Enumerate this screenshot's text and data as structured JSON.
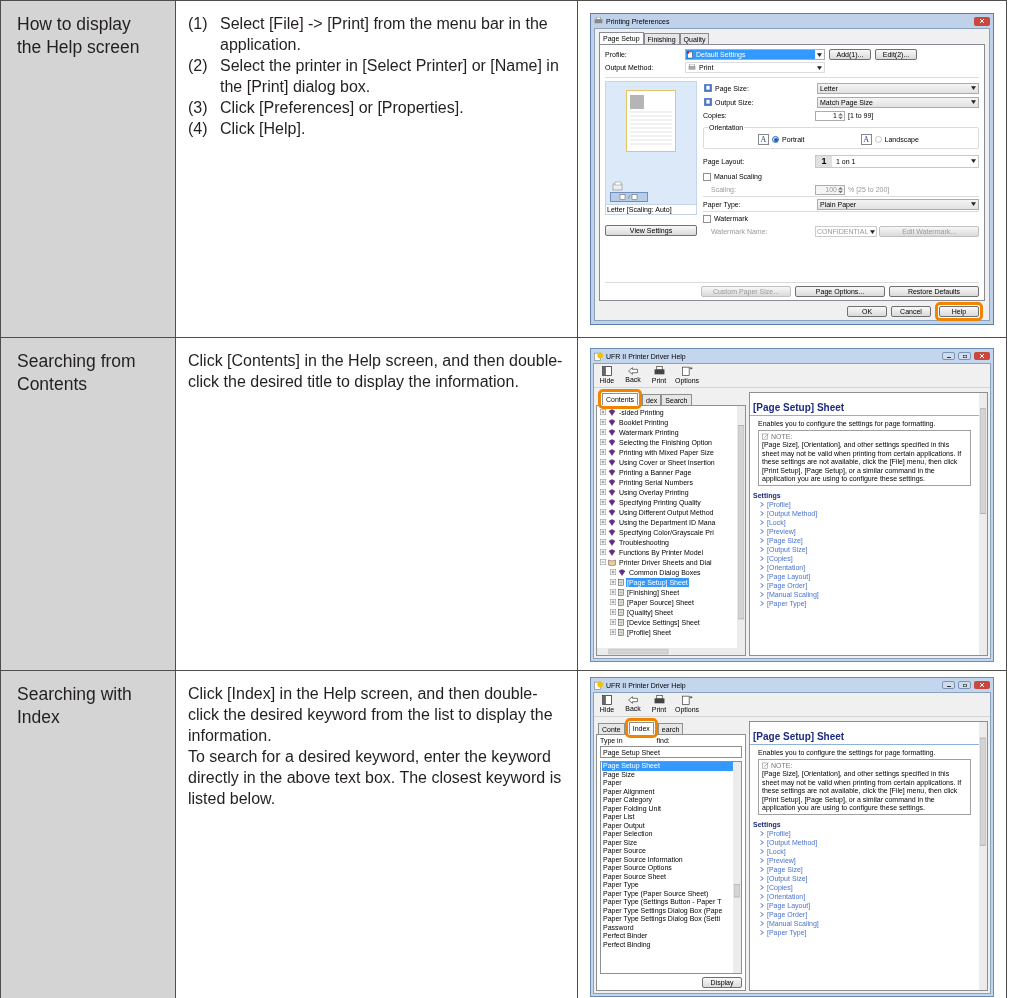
{
  "rows": [
    {
      "heading": "How to display the Help screen",
      "steps": [
        {
          "number": "(1)",
          "text": "Select [File] -> [Print] from the menu bar in the application."
        },
        {
          "number": "(2)",
          "text": "Select the printer in [Select Printer] or [Name] in the [Print] dialog box."
        },
        {
          "number": "(3)",
          "text": "Click [Preferences] or [Properties]."
        },
        {
          "number": "(4)",
          "text": "Click [Help]."
        }
      ],
      "screen": {
        "kind": "printing_preferences",
        "title": "Printing Preferences",
        "tabs": [
          {
            "label": "Page Setup",
            "selected": true
          },
          {
            "label": "Finishing",
            "selected": false
          },
          {
            "label": "Quality",
            "selected": false
          }
        ],
        "profile": {
          "label": "Profile:",
          "value": "Default Settings",
          "buttons": [
            "Add(1)...",
            "Edit(2)..."
          ]
        },
        "output_method": {
          "label": "Output Method:",
          "value": "Print"
        },
        "preview": {
          "caption": "Letter [Scaling: Auto]",
          "button": "View Settings"
        },
        "settings": [
          {
            "kind": "icon_select",
            "label": "Page Size:",
            "value": "Letter"
          },
          {
            "kind": "icon_select",
            "label": "Output Size:",
            "value": "Match Page Size"
          },
          {
            "kind": "spinner",
            "label": "Copies:",
            "value": "1",
            "range": "[1 to 99]",
            "disabled": false
          },
          {
            "kind": "orientation",
            "label": "Orientation",
            "options": [
              {
                "glyph": "A",
                "label": "Portrait",
                "selected": true
              },
              {
                "glyph": "A",
                "label": "Landscape",
                "selected": false
              }
            ]
          },
          {
            "kind": "layout_select",
            "label": "Page Layout:",
            "badge": "1",
            "value": "1 on 1"
          },
          {
            "kind": "checkbox",
            "label": "Manual Scaling",
            "checked": false
          },
          {
            "kind": "spinner",
            "label": "Scaling:",
            "value": "100",
            "range": "% [25 to 200]",
            "disabled": true
          },
          {
            "kind": "select",
            "label": "Paper Type:",
            "value": "Plain Paper"
          },
          {
            "kind": "checkbox",
            "label": "Watermark",
            "checked": false
          },
          {
            "kind": "watermark",
            "label": "Watermark Name:",
            "value": "CONFIDENTIAL",
            "button": "Edit Watermark...",
            "disabled": true
          }
        ],
        "bottom_buttons": [
          {
            "label": "Custom Paper Size...",
            "disabled": true
          },
          {
            "label": "Page Options...",
            "disabled": false
          },
          {
            "label": "Restore Defaults",
            "disabled": false
          }
        ],
        "dialog_buttons": [
          {
            "label": "OK",
            "highlighted": false
          },
          {
            "label": "Cancel",
            "highlighted": false
          },
          {
            "label": "Help",
            "highlighted": true
          }
        ]
      }
    },
    {
      "heading": "Searching from Contents",
      "paragraphs": [
        "Click [Contents] in the Help screen, and then double-click the desired title to display the information."
      ],
      "screen": {
        "kind": "help",
        "title": "UFR II Printer Driver Help",
        "toolbar": [
          "Hide",
          "Back",
          "Print",
          "Options"
        ],
        "tabs": [
          {
            "label": "Contents",
            "selected": true,
            "highlighted": true
          },
          {
            "label": "dex",
            "selected": false,
            "highlighted": false
          },
          {
            "label": "Search",
            "selected": false,
            "highlighted": false
          }
        ],
        "left_pane": {
          "kind": "contents",
          "tree": [
            {
              "label": "-sided Printing",
              "kind": "book",
              "expanded": false,
              "selected": false
            },
            {
              "label": "Booklet Printing",
              "kind": "book",
              "expanded": false,
              "selected": false
            },
            {
              "label": "Watermark Printing",
              "kind": "book",
              "expanded": false,
              "selected": false
            },
            {
              "label": "Selecting the Finishing Option",
              "kind": "book",
              "expanded": false,
              "selected": false
            },
            {
              "label": "Printing with Mixed Paper Size",
              "kind": "book",
              "expanded": false,
              "selected": false
            },
            {
              "label": "Using Cover or Sheet Insertion",
              "kind": "book",
              "expanded": false,
              "selected": false
            },
            {
              "label": "Printing a Banner Page",
              "kind": "book",
              "expanded": false,
              "selected": false
            },
            {
              "label": "Printing Serial Numbers",
              "kind": "book",
              "expanded": false,
              "selected": false
            },
            {
              "label": "Using Overlay Printing",
              "kind": "book",
              "expanded": false,
              "selected": false
            },
            {
              "label": "Specifying Printing Quality",
              "kind": "book",
              "expanded": false,
              "selected": false
            },
            {
              "label": "Using Different Output Method",
              "kind": "book",
              "expanded": false,
              "selected": false
            },
            {
              "label": "Using the Department ID Mana",
              "kind": "book",
              "expanded": false,
              "selected": false
            },
            {
              "label": "Specifying Color/Grayscale Pri",
              "kind": "book",
              "expanded": false,
              "selected": false
            },
            {
              "label": "Troubleshooting",
              "kind": "book",
              "expanded": false,
              "selected": false
            },
            {
              "label": "Functions By Printer Model",
              "kind": "book",
              "expanded": false,
              "selected": false
            },
            {
              "label": "Printer Driver Sheets and Dial",
              "kind": "book",
              "expanded": true,
              "selected": false,
              "children": [
                {
                  "label": "Common Dialog Boxes",
                  "kind": "book",
                  "expanded": false,
                  "selected": false
                },
                {
                  "label": "[Page Setup] Sheet",
                  "kind": "page",
                  "expanded": false,
                  "selected": true
                },
                {
                  "label": "[Finishing] Sheet",
                  "kind": "page",
                  "expanded": false,
                  "selected": false
                },
                {
                  "label": "[Paper Source] Sheet",
                  "kind": "page",
                  "expanded": false,
                  "selected": false
                },
                {
                  "label": "[Quality] Sheet",
                  "kind": "page",
                  "expanded": false,
                  "selected": false
                },
                {
                  "label": "[Device Settings] Sheet",
                  "kind": "page",
                  "expanded": false,
                  "selected": false
                },
                {
                  "label": "[Profile] Sheet",
                  "kind": "page",
                  "expanded": false,
                  "selected": false
                }
              ]
            }
          ]
        },
        "topic": {
          "heading": "[Page Setup] Sheet",
          "intro": "Enables you to configure the settings for page formatting.",
          "note_label": "NOTE:",
          "note": "[Page Size], [Orientation], and other settings specified in this sheet may not be valid when printing from certain applications. If these settings are not available, click the [File] menu, then click [Print Setup], [Page Setup], or a similar command in the application you are using to configure these settings.",
          "section": "Settings",
          "links": [
            "[Profile]",
            "[Output Method]",
            "[Lock]",
            "[Preview]",
            "[Page Size]",
            "[Output Size]",
            "[Copies]",
            "[Orientation]",
            "[Page Layout]",
            "[Page Order]",
            "[Manual Scaling]",
            "[Paper Type]"
          ]
        }
      }
    },
    {
      "heading": "Searching with Index",
      "paragraphs": [
        "Click [Index] in the Help screen, and then double-click the desired keyword from the list to display the information.",
        "To search for a desired keyword, enter the keyword directly in the above text box. The closest keyword is listed below."
      ],
      "screen": {
        "kind": "help",
        "title": "UFR II Printer Driver Help",
        "toolbar": [
          "Hide",
          "Back",
          "Print",
          "Options"
        ],
        "tabs": [
          {
            "label": "Conte",
            "selected": false,
            "highlighted": false
          },
          {
            "label": "Index",
            "selected": true,
            "highlighted": true
          },
          {
            "label": "earch",
            "selected": false,
            "highlighted": false
          }
        ],
        "left_pane": {
          "kind": "index",
          "prompt": [
            "Type in",
            "find:"
          ],
          "query": "Page Setup Sheet",
          "button": "Display",
          "items": [
            {
              "label": "Page Setup Sheet",
              "selected": true
            },
            {
              "label": "Page Size",
              "selected": false
            },
            {
              "label": "Paper",
              "selected": false
            },
            {
              "label": "Paper Alignment",
              "selected": false
            },
            {
              "label": "Paper Category",
              "selected": false
            },
            {
              "label": "Paper Folding Unit",
              "selected": false
            },
            {
              "label": "Paper List",
              "selected": false
            },
            {
              "label": "Paper Output",
              "selected": false
            },
            {
              "label": "Paper Selection",
              "selected": false
            },
            {
              "label": "Paper Size",
              "selected": false
            },
            {
              "label": "Paper Source",
              "selected": false
            },
            {
              "label": "Paper Source Information",
              "selected": false
            },
            {
              "label": "Paper Source Options",
              "selected": false
            },
            {
              "label": "Paper Source Sheet",
              "selected": false
            },
            {
              "label": "Paper Type",
              "selected": false
            },
            {
              "label": "Paper Type (Paper Source Sheet)",
              "selected": false
            },
            {
              "label": "Paper Type (Settings Button - Paper T",
              "selected": false
            },
            {
              "label": "Paper Type Settings Dialog Box (Pape",
              "selected": false
            },
            {
              "label": "Paper Type Settings Dialog Box (Setti",
              "selected": false
            },
            {
              "label": "Password",
              "selected": false
            },
            {
              "label": "Perfect Binder",
              "selected": false
            },
            {
              "label": "Perfect Binding",
              "selected": false
            }
          ]
        },
        "topic": {
          "heading": "[Page Setup] Sheet",
          "intro": "Enables you to configure the settings for page formatting.",
          "note_label": "NOTE:",
          "note": "[Page Size], [Orientation], and other settings specified in this sheet may not be valid when printing from certain applications. If these settings are not available, click the [File] menu, then click [Print Setup], [Page Setup], or a similar command in the application you are using to configure these settings.",
          "section": "Settings",
          "links": [
            "[Profile]",
            "[Output Method]",
            "[Lock]",
            "[Preview]",
            "[Page Size]",
            "[Output Size]",
            "[Copies]",
            "[Orientation]",
            "[Page Layout]",
            "[Page Order]",
            "[Manual Scaling]",
            "[Paper Type]"
          ]
        }
      }
    }
  ]
}
